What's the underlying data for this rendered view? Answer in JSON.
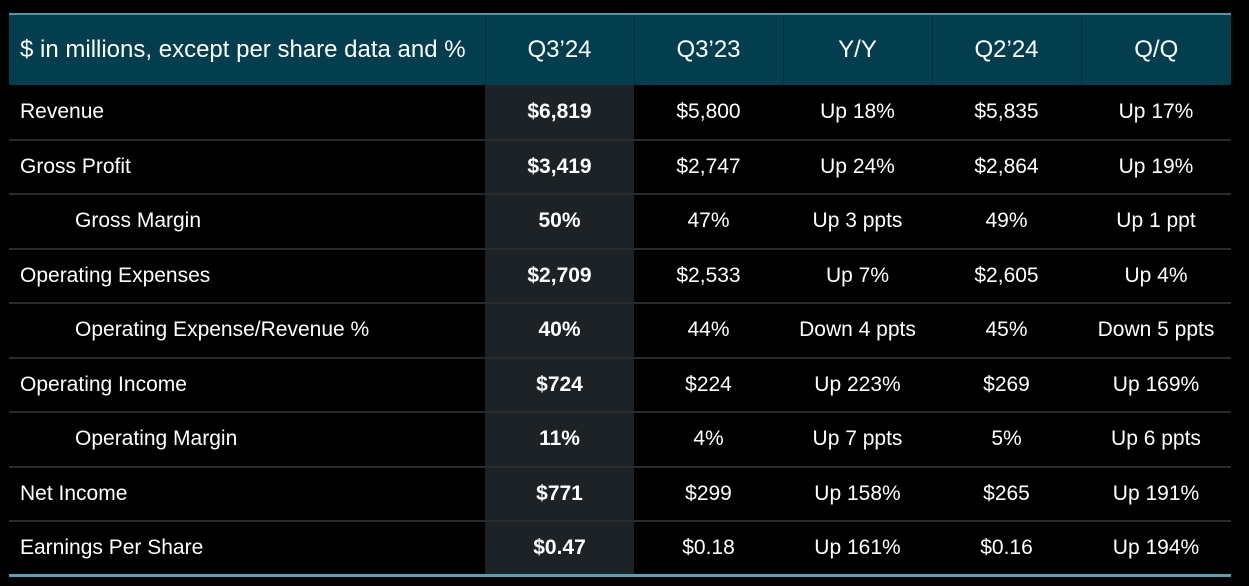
{
  "table": {
    "header": {
      "label": "$ in millions, except per share data and %",
      "columns": [
        "Q3’24",
        "Q3’23",
        "Y/Y",
        "Q2’24",
        "Q/Q"
      ]
    },
    "highlight_column": "Q3’24",
    "colors": {
      "header_background": "#023e4e",
      "header_top_border": "#4f98a8",
      "highlight_column_background": "#1c2226",
      "row_divider": "#2a2a2a",
      "bottom_border": "#5aa0b0",
      "page_background": "#000000",
      "text": "#ffffff"
    },
    "rows": [
      {
        "label": "Revenue",
        "indented": false,
        "q3_24": "$6,819",
        "q3_23": "$5,800",
        "yy": "Up 18%",
        "q2_24": "$5,835",
        "qq": "Up 17%"
      },
      {
        "label": "Gross Profit",
        "indented": false,
        "q3_24": "$3,419",
        "q3_23": "$2,747",
        "yy": "Up 24%",
        "q2_24": "$2,864",
        "qq": "Up 19%"
      },
      {
        "label": "Gross Margin",
        "indented": true,
        "q3_24": "50%",
        "q3_23": "47%",
        "yy": "Up 3 ppts",
        "q2_24": "49%",
        "qq": "Up 1 ppt"
      },
      {
        "label": "Operating Expenses",
        "indented": false,
        "q3_24": "$2,709",
        "q3_23": "$2,533",
        "yy": "Up 7%",
        "q2_24": "$2,605",
        "qq": "Up 4%"
      },
      {
        "label": "Operating Expense/Revenue %",
        "indented": true,
        "q3_24": "40%",
        "q3_23": "44%",
        "yy": "Down 4 ppts",
        "q2_24": "45%",
        "qq": "Down 5 ppts"
      },
      {
        "label": "Operating Income",
        "indented": false,
        "q3_24": "$724",
        "q3_23": "$224",
        "yy": "Up 223%",
        "q2_24": "$269",
        "qq": "Up 169%"
      },
      {
        "label": "Operating Margin",
        "indented": true,
        "q3_24": "11%",
        "q3_23": "4%",
        "yy": "Up 7 ppts",
        "q2_24": "5%",
        "qq": "Up 6 ppts"
      },
      {
        "label": "Net Income",
        "indented": false,
        "q3_24": "$771",
        "q3_23": "$299",
        "yy": "Up 158%",
        "q2_24": "$265",
        "qq": "Up 191%"
      },
      {
        "label": "Earnings Per Share",
        "indented": false,
        "q3_24": "$0.47",
        "q3_23": "$0.18",
        "yy": "Up 161%",
        "q2_24": "$0.16",
        "qq": "Up 194%"
      }
    ]
  }
}
